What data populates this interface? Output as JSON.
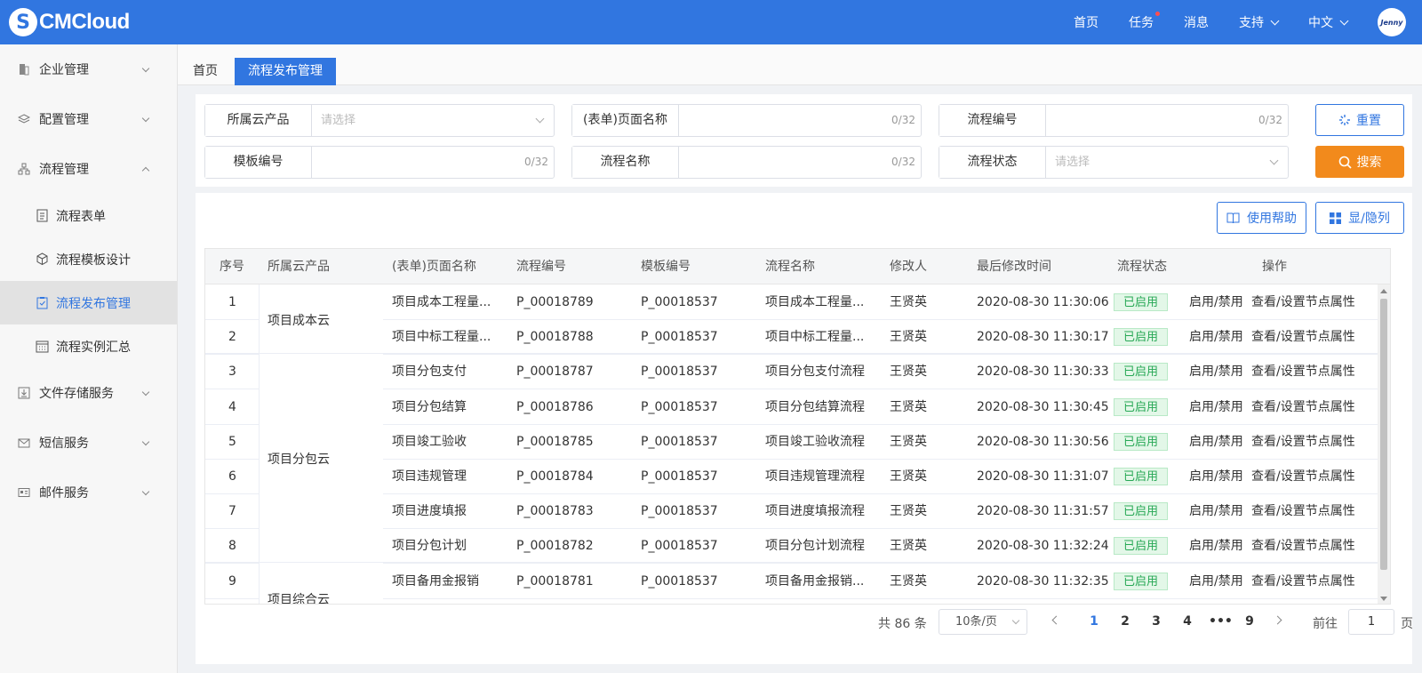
{
  "header": {
    "brand": "CMCloud",
    "nav": [
      "首页",
      "任务",
      "消息",
      "支持",
      "中文"
    ],
    "avatar_text": "Jenny"
  },
  "sidebar": {
    "menus": [
      {
        "label": "企业管理",
        "icon": "building-icon"
      },
      {
        "label": "配置管理",
        "icon": "layers-icon"
      },
      {
        "label": "流程管理",
        "icon": "flow-icon"
      },
      {
        "label": "文件存储服务",
        "icon": "download-icon"
      },
      {
        "label": "短信服务",
        "icon": "mail-icon"
      },
      {
        "label": "邮件服务",
        "icon": "id-card-icon"
      }
    ],
    "submenus": [
      {
        "label": "流程表单",
        "icon": "form-icon"
      },
      {
        "label": "流程模板设计",
        "icon": "cube-icon"
      },
      {
        "label": "流程发布管理",
        "icon": "clipboard-check-icon"
      },
      {
        "label": "流程实例汇总",
        "icon": "calendar-icon"
      }
    ]
  },
  "tabs": {
    "home": "首页",
    "active": "流程发布管理"
  },
  "search": {
    "product_label": "所属云产品",
    "product_placeholder": "请选择",
    "page_name_label": "(表单)页面名称",
    "page_name_count": "0/32",
    "process_no_label": "流程编号",
    "process_no_count": "0/32",
    "template_no_label": "模板编号",
    "template_no_count": "0/32",
    "process_name_label": "流程名称",
    "process_name_count": "0/32",
    "status_label": "流程状态",
    "status_placeholder": "请选择",
    "reset_label": "重置",
    "search_label": "搜索"
  },
  "toolbar": {
    "help_label": "使用帮助",
    "columns_label": "显/隐列"
  },
  "table": {
    "headers": [
      "序号",
      "所属云产品",
      "(表单)页面名称",
      "流程编号",
      "模板编号",
      "流程名称",
      "修改人",
      "最后修改时间",
      "流程状态",
      "操作"
    ],
    "groups": [
      "项目成本云",
      "项目分包云",
      "项目综合云"
    ],
    "rows": [
      {
        "seq": "1",
        "page": "项目成本工程量...",
        "pno": "P_00018789",
        "tno": "P_00018537",
        "name": "项目成本工程量...",
        "user": "王贤英",
        "time": "2020-08-30 11:30:06",
        "status": "已启用",
        "act1": "启用/禁用",
        "act2": "查看/设置节点属性"
      },
      {
        "seq": "2",
        "page": "项目中标工程量...",
        "pno": "P_00018788",
        "tno": "P_00018537",
        "name": "项目中标工程量...",
        "user": "王贤英",
        "time": "2020-08-30 11:30:17",
        "status": "已启用",
        "act1": "启用/禁用",
        "act2": "查看/设置节点属性"
      },
      {
        "seq": "3",
        "page": "项目分包支付",
        "pno": "P_00018787",
        "tno": "P_00018537",
        "name": "项目分包支付流程",
        "user": "王贤英",
        "time": "2020-08-30 11:30:33",
        "status": "已启用",
        "act1": "启用/禁用",
        "act2": "查看/设置节点属性"
      },
      {
        "seq": "4",
        "page": "项目分包结算",
        "pno": "P_00018786",
        "tno": "P_00018537",
        "name": "项目分包结算流程",
        "user": "王贤英",
        "time": "2020-08-30 11:30:45",
        "status": "已启用",
        "act1": "启用/禁用",
        "act2": "查看/设置节点属性"
      },
      {
        "seq": "5",
        "page": "项目竣工验收",
        "pno": "P_00018785",
        "tno": "P_00018537",
        "name": "项目竣工验收流程",
        "user": "王贤英",
        "time": "2020-08-30 11:30:56",
        "status": "已启用",
        "act1": "启用/禁用",
        "act2": "查看/设置节点属性"
      },
      {
        "seq": "6",
        "page": "项目违规管理",
        "pno": "P_00018784",
        "tno": "P_00018537",
        "name": "项目违规管理流程",
        "user": "王贤英",
        "time": "2020-08-30 11:31:07",
        "status": "已启用",
        "act1": "启用/禁用",
        "act2": "查看/设置节点属性"
      },
      {
        "seq": "7",
        "page": "项目进度填报",
        "pno": "P_00018783",
        "tno": "P_00018537",
        "name": "项目进度填报流程",
        "user": "王贤英",
        "time": "2020-08-30 11:31:57",
        "status": "已启用",
        "act1": "启用/禁用",
        "act2": "查看/设置节点属性"
      },
      {
        "seq": "8",
        "page": "项目分包计划",
        "pno": "P_00018782",
        "tno": "P_00018537",
        "name": "项目分包计划流程",
        "user": "王贤英",
        "time": "2020-08-30 11:32:24",
        "status": "已启用",
        "act1": "启用/禁用",
        "act2": "查看/设置节点属性"
      },
      {
        "seq": "9",
        "page": "项目备用金报销",
        "pno": "P_00018781",
        "tno": "P_00018537",
        "name": "项目备用金报销...",
        "user": "王贤英",
        "time": "2020-08-30 11:32:35",
        "status": "已启用",
        "act1": "启用/禁用",
        "act2": "查看/设置节点属性"
      }
    ]
  },
  "pager": {
    "total": "共 86 条",
    "page_size": "10条/页",
    "pages": [
      "1",
      "2",
      "3",
      "4",
      "•••",
      "9"
    ],
    "goto_label": "前往",
    "current": "1",
    "page_suffix": "页"
  },
  "colors": {
    "primary": "#3176e0",
    "accent": "#f28a1c",
    "danger_link": "#f2621c",
    "success": "#27a855"
  }
}
